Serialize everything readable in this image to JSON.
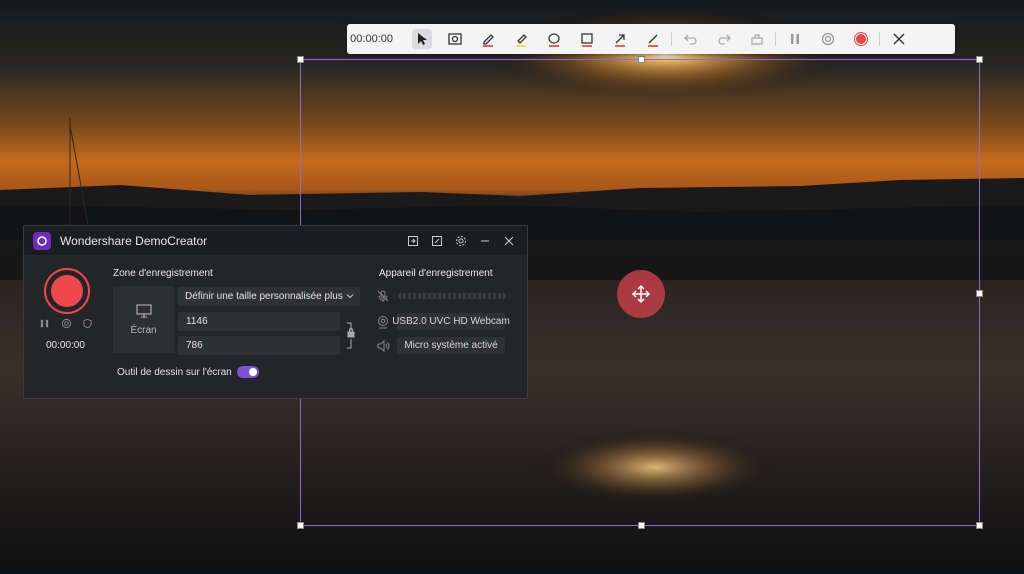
{
  "toolbar": {
    "timer": "00:00:00",
    "tools": [
      "cursor-icon",
      "screenshot-icon",
      "pen-icon",
      "highlighter-icon",
      "ellipse-icon",
      "rectangle-icon",
      "arrow-icon",
      "line-icon",
      "undo-icon",
      "redo-icon",
      "eraser-icon",
      "pause-icon",
      "camera-toggle-icon",
      "record-icon",
      "close-icon"
    ],
    "accent": "#f04848"
  },
  "selection": {
    "accent": "#8b69d8"
  },
  "window": {
    "title": "Wondershare DemoCreator",
    "timer": "00:00:00",
    "recording_area": {
      "heading": "Zone d'enregistrement",
      "screen_label": "Écran",
      "preset": "Définir une taille personnalisée plus ta",
      "width": "1146",
      "height": "786"
    },
    "drawing_tool": {
      "label": "Outil de dessin sur l'écran",
      "enabled": true
    },
    "devices": {
      "heading": "Appareil d'enregistrement",
      "webcam": "USB2.0 UVC HD Webcam",
      "system_audio": "Micro système activé"
    },
    "colors": {
      "record": "#f04848",
      "toggle": "#7b54d6",
      "logo": "#6b2fbf"
    }
  }
}
